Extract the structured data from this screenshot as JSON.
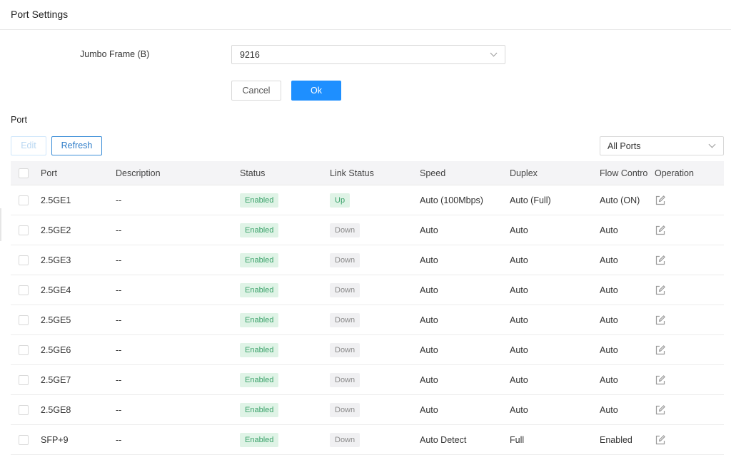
{
  "page": {
    "title": "Port Settings"
  },
  "jumbo": {
    "label": "Jumbo Frame (B)",
    "value": "9216",
    "cancel_label": "Cancel",
    "ok_label": "Ok"
  },
  "port_section": {
    "label": "Port",
    "edit_label": "Edit",
    "refresh_label": "Refresh",
    "filter_value": "All Ports"
  },
  "table": {
    "columns": [
      "Port",
      "Description",
      "Status",
      "Link Status",
      "Speed",
      "Duplex",
      "Flow Control",
      "Operation"
    ],
    "rows": [
      {
        "port": "2.5GE1",
        "description": "--",
        "status": "Enabled",
        "link": "Up",
        "speed": "Auto (100Mbps)",
        "duplex": "Auto (Full)",
        "flow": "Auto (ON)"
      },
      {
        "port": "2.5GE2",
        "description": "--",
        "status": "Enabled",
        "link": "Down",
        "speed": "Auto",
        "duplex": "Auto",
        "flow": "Auto"
      },
      {
        "port": "2.5GE3",
        "description": "--",
        "status": "Enabled",
        "link": "Down",
        "speed": "Auto",
        "duplex": "Auto",
        "flow": "Auto"
      },
      {
        "port": "2.5GE4",
        "description": "--",
        "status": "Enabled",
        "link": "Down",
        "speed": "Auto",
        "duplex": "Auto",
        "flow": "Auto"
      },
      {
        "port": "2.5GE5",
        "description": "--",
        "status": "Enabled",
        "link": "Down",
        "speed": "Auto",
        "duplex": "Auto",
        "flow": "Auto"
      },
      {
        "port": "2.5GE6",
        "description": "--",
        "status": "Enabled",
        "link": "Down",
        "speed": "Auto",
        "duplex": "Auto",
        "flow": "Auto"
      },
      {
        "port": "2.5GE7",
        "description": "--",
        "status": "Enabled",
        "link": "Down",
        "speed": "Auto",
        "duplex": "Auto",
        "flow": "Auto"
      },
      {
        "port": "2.5GE8",
        "description": "--",
        "status": "Enabled",
        "link": "Down",
        "speed": "Auto",
        "duplex": "Auto",
        "flow": "Auto"
      },
      {
        "port": "SFP+9",
        "description": "--",
        "status": "Enabled",
        "link": "Down",
        "speed": "Auto Detect",
        "duplex": "Full",
        "flow": "Enabled"
      }
    ]
  },
  "icons": {
    "row_action": "edit-icon",
    "dropdown": "chevron-down-icon"
  },
  "colors": {
    "accent": "#1e8fff",
    "enabled_badge_bg": "#dff3e6",
    "enabled_badge_text": "#3aa26a",
    "down_badge_bg": "#f0f0f2"
  }
}
